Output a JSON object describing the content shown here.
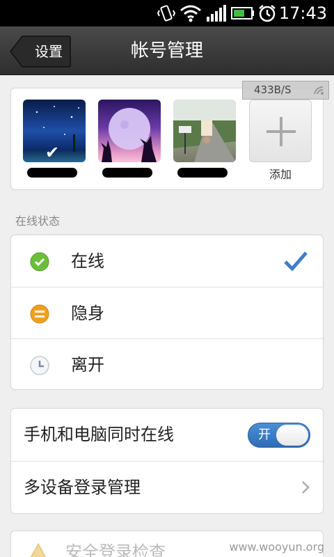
{
  "status_bar": {
    "time": "17:43"
  },
  "titlebar": {
    "back_label": "设置",
    "title": "帐号管理"
  },
  "accounts": {
    "add_label": "添加",
    "net_speed": "433B/S"
  },
  "online_status": {
    "section_label": "在线状态",
    "items": [
      {
        "label": "在线",
        "icon": "online-green-icon",
        "selected": true
      },
      {
        "label": "隐身",
        "icon": "invisible-orange-icon",
        "selected": false
      },
      {
        "label": "离开",
        "icon": "away-clock-icon",
        "selected": false
      }
    ]
  },
  "settings": {
    "simultaneous_online_label": "手机和电脑同时在线",
    "toggle_on_label": "开",
    "multi_device_label": "多设备登录管理"
  },
  "bottom": {
    "label": "安全登录检查"
  },
  "watermark": "www.wooyun.org",
  "colors": {
    "accent_blue": "#3f7fc6",
    "titlebar": "#3a3a3a",
    "online_green": "#6bbf3a",
    "invisible_orange": "#f0a020"
  }
}
